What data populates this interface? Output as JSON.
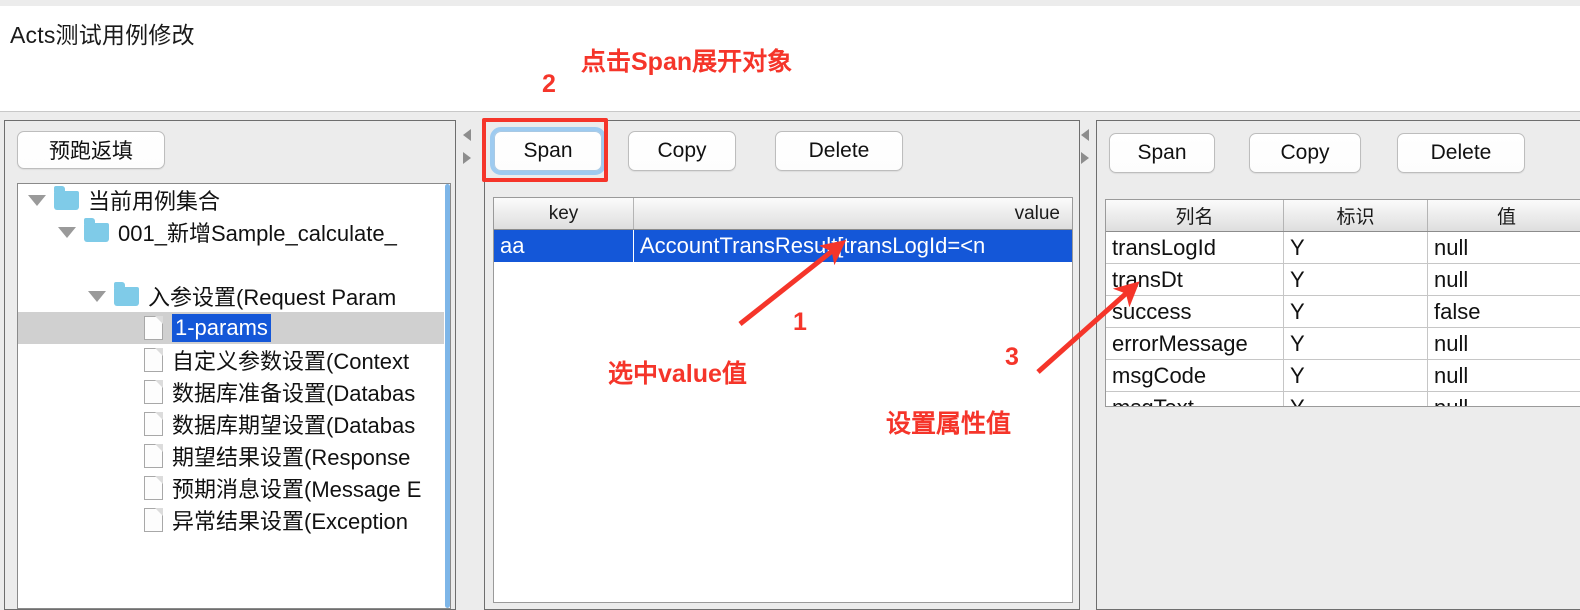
{
  "header": {
    "title": "Acts测试用例修改"
  },
  "annotations": [
    {
      "number": "1",
      "text": "选中value值"
    },
    {
      "number": "2",
      "text": "点击Span展开对象"
    },
    {
      "number": "3",
      "text": "设置属性值"
    }
  ],
  "colors": {
    "annotation": "#f5352a",
    "selection": "#1457d8",
    "focus_ring": "#9ecbf0",
    "folder": "#7fcbe8"
  },
  "left_panel": {
    "prerun_button": "预跑返填",
    "tree": [
      {
        "label": "当前用例集合",
        "icon": "folder-icon",
        "twisty": "expanded",
        "depth": 0,
        "selected": false
      },
      {
        "label": "001_新增Sample_calculate_",
        "icon": "folder-icon",
        "twisty": "expanded",
        "depth": 1,
        "selected": false
      },
      {
        "label": "",
        "icon": "none",
        "twisty": "none",
        "depth": 1,
        "selected": false
      },
      {
        "label": "入参设置(Request Param",
        "icon": "folder-icon",
        "twisty": "expanded",
        "depth": 2,
        "selected": false
      },
      {
        "label": "1-params",
        "icon": "file-icon",
        "twisty": "none",
        "depth": 3,
        "selected": true
      },
      {
        "label": "自定义参数设置(Context",
        "icon": "file-icon",
        "twisty": "none",
        "depth": 3,
        "selected": false
      },
      {
        "label": "数据库准备设置(Databas",
        "icon": "file-icon",
        "twisty": "none",
        "depth": 3,
        "selected": false
      },
      {
        "label": "数据库期望设置(Databas",
        "icon": "file-icon",
        "twisty": "none",
        "depth": 3,
        "selected": false
      },
      {
        "label": "期望结果设置(Response",
        "icon": "file-icon",
        "twisty": "none",
        "depth": 3,
        "selected": false
      },
      {
        "label": "预期消息设置(Message E",
        "icon": "file-icon",
        "twisty": "none",
        "depth": 3,
        "selected": false
      },
      {
        "label": "异常结果设置(Exception",
        "icon": "file-icon",
        "twisty": "none",
        "depth": 3,
        "selected": false
      }
    ]
  },
  "middle_panel": {
    "buttons": [
      {
        "label": "Span",
        "focused": true
      },
      {
        "label": "Copy",
        "focused": false
      },
      {
        "label": "Delete",
        "focused": false
      }
    ],
    "table": {
      "headers": [
        "key",
        "value"
      ],
      "rows": [
        {
          "key": "aa",
          "value": "AccountTransResult[transLogId=<n",
          "selected": true
        }
      ]
    }
  },
  "right_panel": {
    "buttons": [
      {
        "label": "Span",
        "focused": false
      },
      {
        "label": "Copy",
        "focused": false
      },
      {
        "label": "Delete",
        "focused": false
      }
    ],
    "table": {
      "headers": [
        "列名",
        "标识",
        "值"
      ],
      "rows": [
        {
          "name": "transLogId",
          "flag": "Y",
          "value": "null"
        },
        {
          "name": "transDt",
          "flag": "Y",
          "value": "null"
        },
        {
          "name": "success",
          "flag": "Y",
          "value": "false"
        },
        {
          "name": "errorMessage",
          "flag": "Y",
          "value": "null"
        },
        {
          "name": "msgCode",
          "flag": "Y",
          "value": "null"
        },
        {
          "name": "msgText",
          "flag": "Y",
          "value": "null"
        }
      ]
    }
  },
  "splitters": [
    {
      "name": "left-splitter",
      "arrows": [
        "collapse-left-icon",
        "collapse-right-icon"
      ]
    },
    {
      "name": "right-splitter",
      "arrows": [
        "collapse-left-icon",
        "collapse-right-icon"
      ]
    }
  ]
}
